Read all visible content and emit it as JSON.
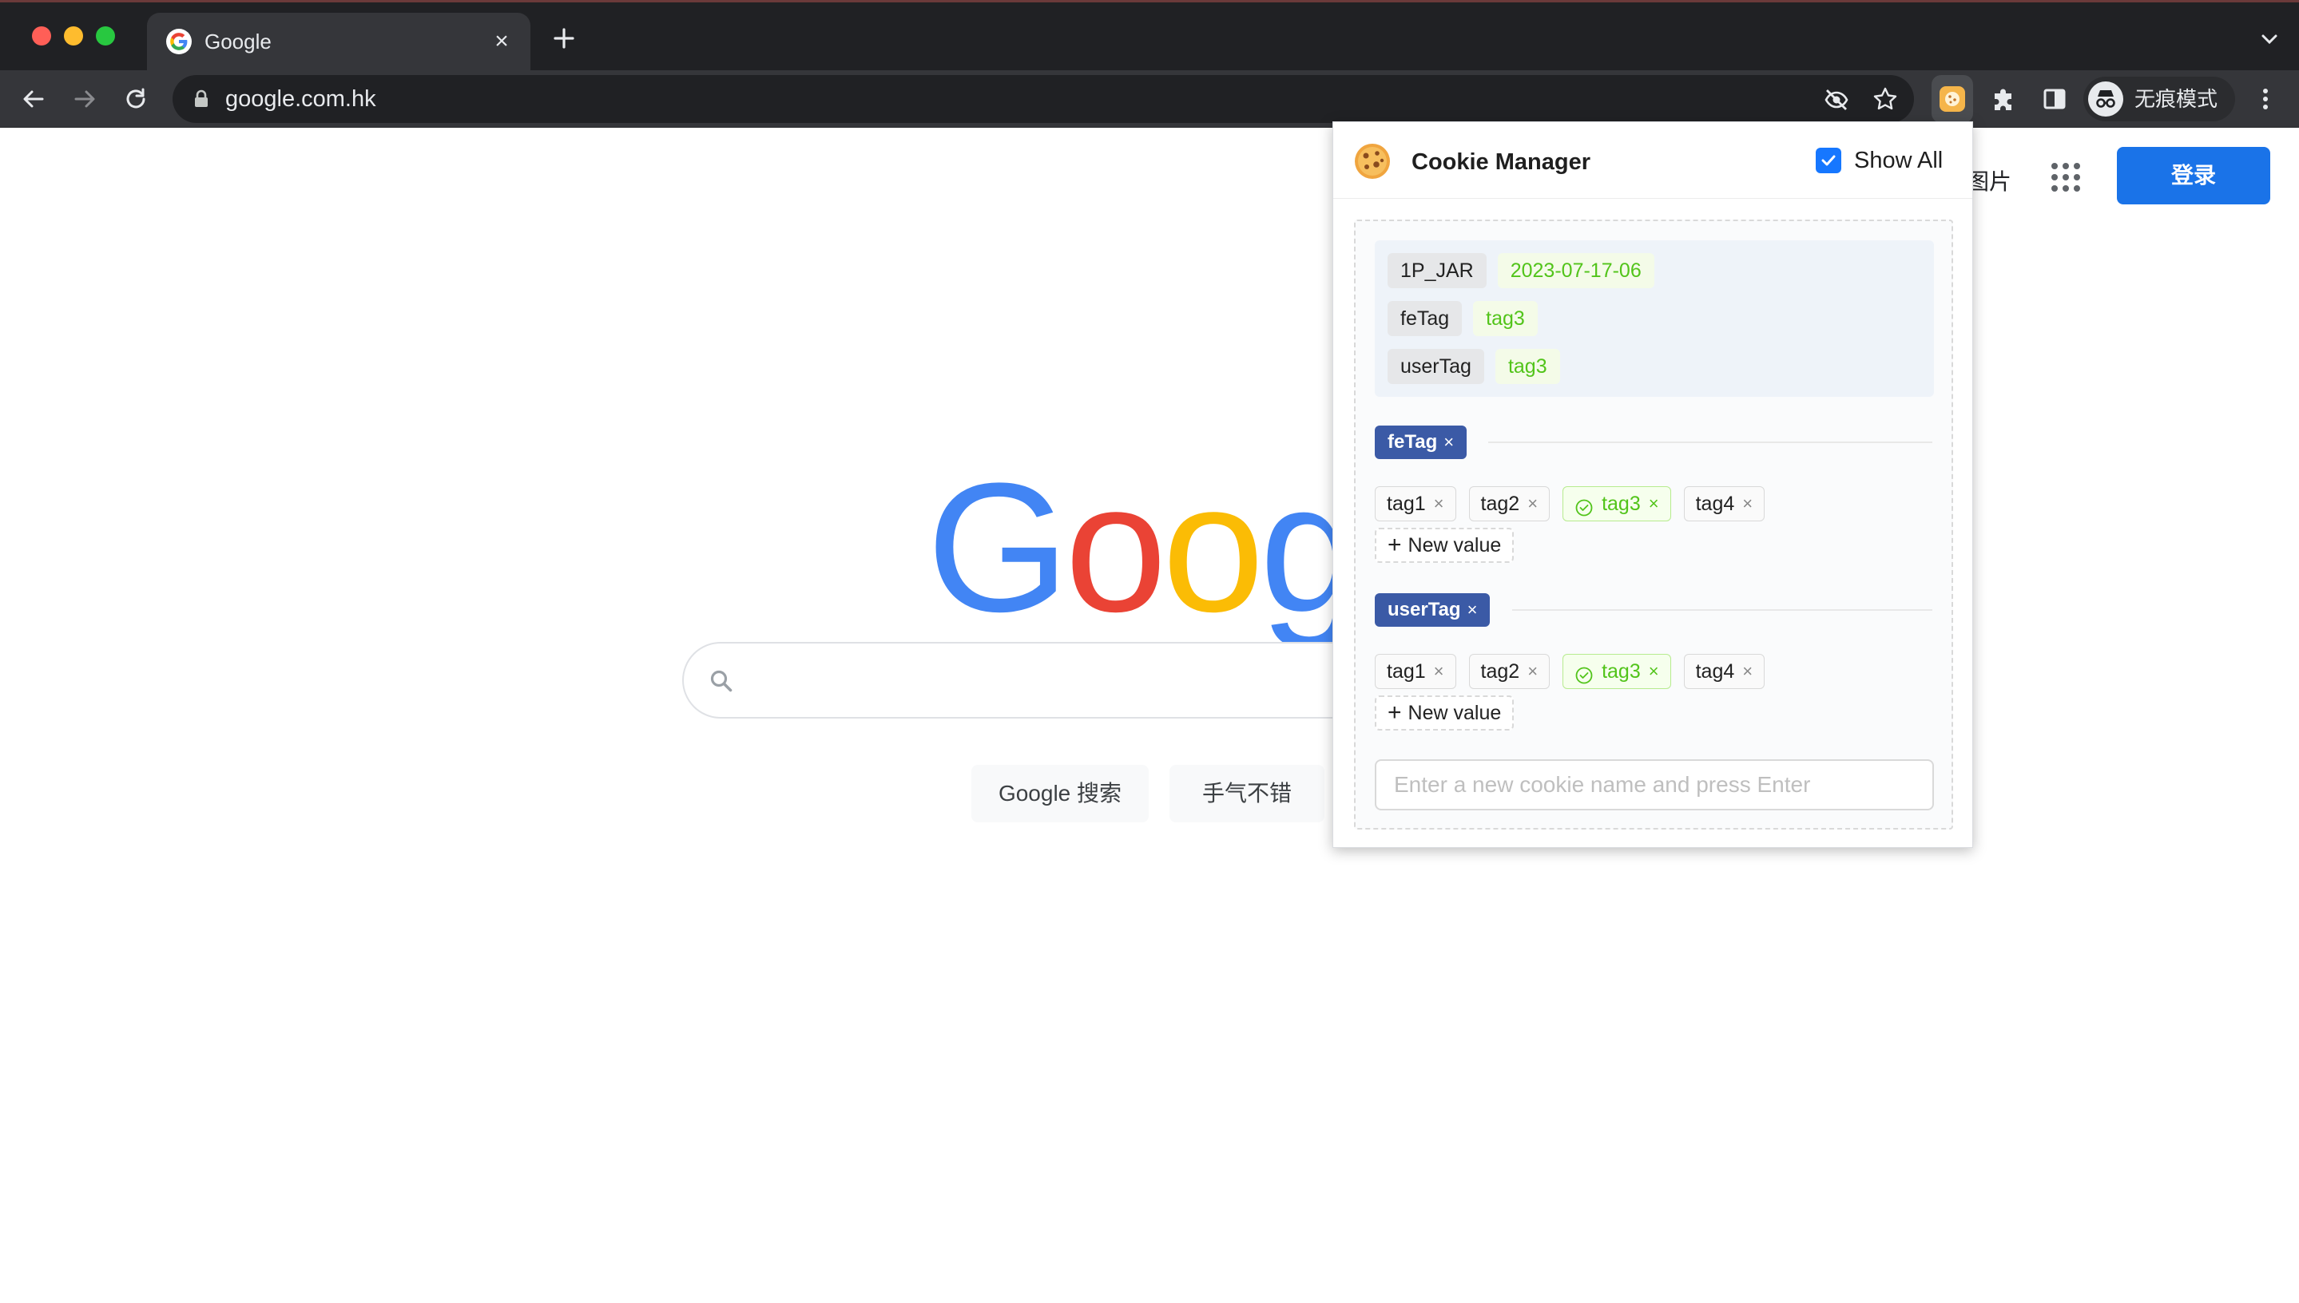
{
  "browser": {
    "tab_title": "Google",
    "url": "google.com.hk",
    "incognito_label": "无痕模式"
  },
  "google": {
    "header_partial_text": "图片",
    "signin_label": "登录",
    "logo_text": "Google",
    "search_button": "Google 搜索",
    "lucky_button": "手气不错"
  },
  "cookie_manager": {
    "title": "Cookie Manager",
    "show_all_label": "Show All",
    "show_all_checked": true,
    "summary": [
      {
        "name": "1P_JAR",
        "value": "2023-07-17-06"
      },
      {
        "name": "feTag",
        "value": "tag3"
      },
      {
        "name": "userTag",
        "value": "tag3"
      }
    ],
    "groups": [
      {
        "name": "feTag",
        "close": "×",
        "tags": [
          {
            "label": "tag1",
            "selected": false
          },
          {
            "label": "tag2",
            "selected": false
          },
          {
            "label": "tag3",
            "selected": true
          },
          {
            "label": "tag4",
            "selected": false
          }
        ],
        "new_value_label": "New value"
      },
      {
        "name": "userTag",
        "close": "×",
        "tags": [
          {
            "label": "tag1",
            "selected": false
          },
          {
            "label": "tag2",
            "selected": false
          },
          {
            "label": "tag3",
            "selected": true
          },
          {
            "label": "tag4",
            "selected": false
          }
        ],
        "new_value_label": "New value"
      }
    ],
    "new_cookie_placeholder": "Enter a new cookie name and press Enter",
    "tag_close_glyph": "×"
  },
  "colors": {
    "primary": "#1677ff",
    "group_header": "#3b5aa6",
    "selected_tag": "#52c41a",
    "signin": "#1a73e8"
  }
}
